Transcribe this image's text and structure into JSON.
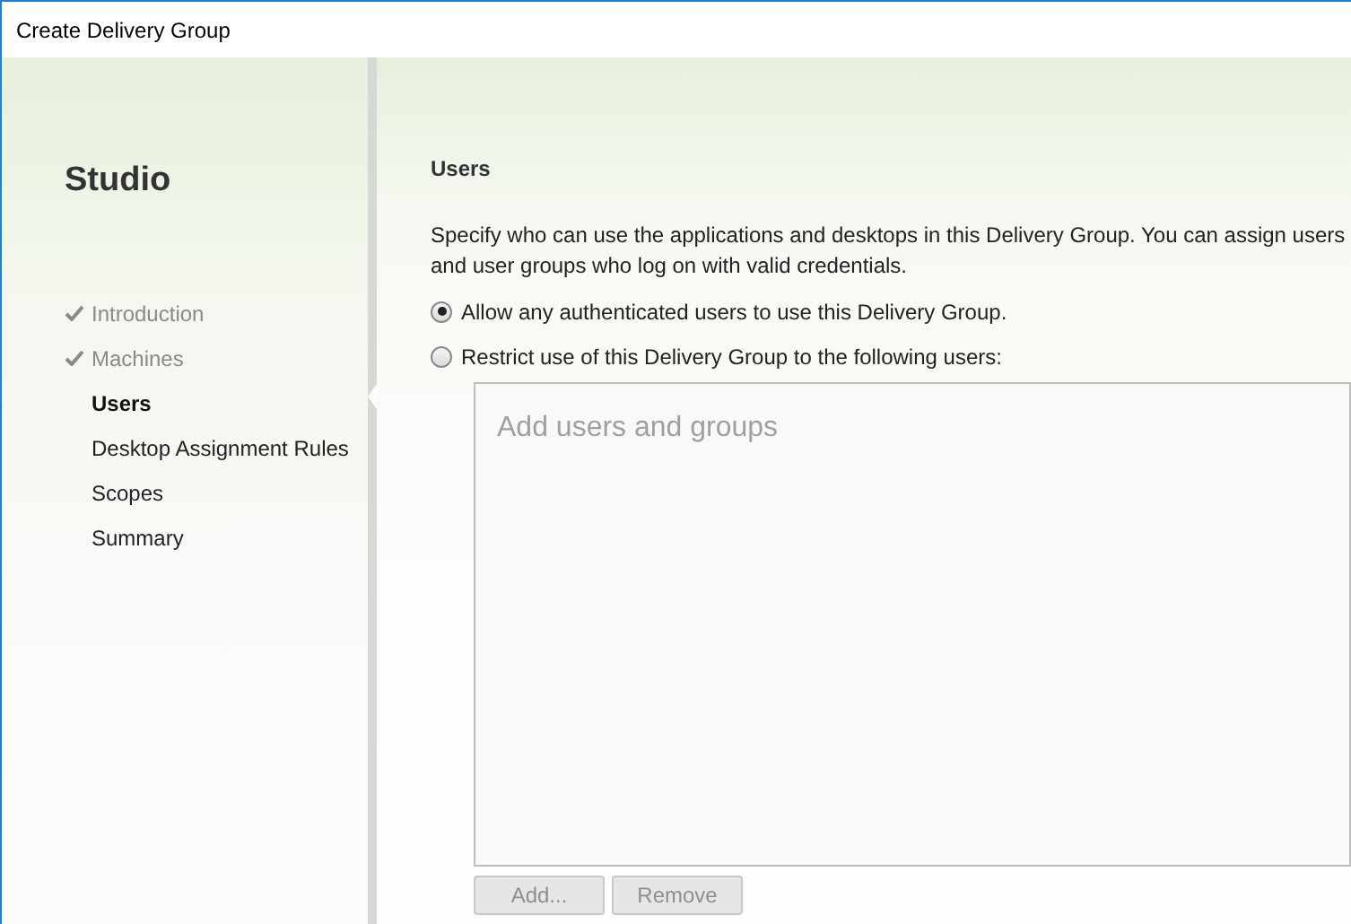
{
  "window": {
    "title": "Create Delivery Group"
  },
  "sidebar": {
    "title": "Studio",
    "steps": [
      {
        "label": "Introduction",
        "completed": true,
        "selected": false
      },
      {
        "label": "Machines",
        "completed": true,
        "selected": false
      },
      {
        "label": "Users",
        "completed": false,
        "selected": true
      },
      {
        "label": "Desktop Assignment Rules",
        "completed": false,
        "selected": false
      },
      {
        "label": "Scopes",
        "completed": false,
        "selected": false
      },
      {
        "label": "Summary",
        "completed": false,
        "selected": false
      }
    ]
  },
  "content": {
    "heading": "Users",
    "description": "Specify who can use the applications and desktops in this Delivery Group. You can assign users and user groups who log on with valid credentials.",
    "options": [
      {
        "label": "Allow any authenticated users to use this Delivery Group.",
        "selected": true
      },
      {
        "label": "Restrict use of this Delivery Group to the following users:",
        "selected": false
      }
    ],
    "user_list": {
      "placeholder": "Add users and groups"
    },
    "buttons": [
      {
        "label": "Add...",
        "disabled": true
      },
      {
        "label": "Remove",
        "disabled": true
      }
    ]
  }
}
